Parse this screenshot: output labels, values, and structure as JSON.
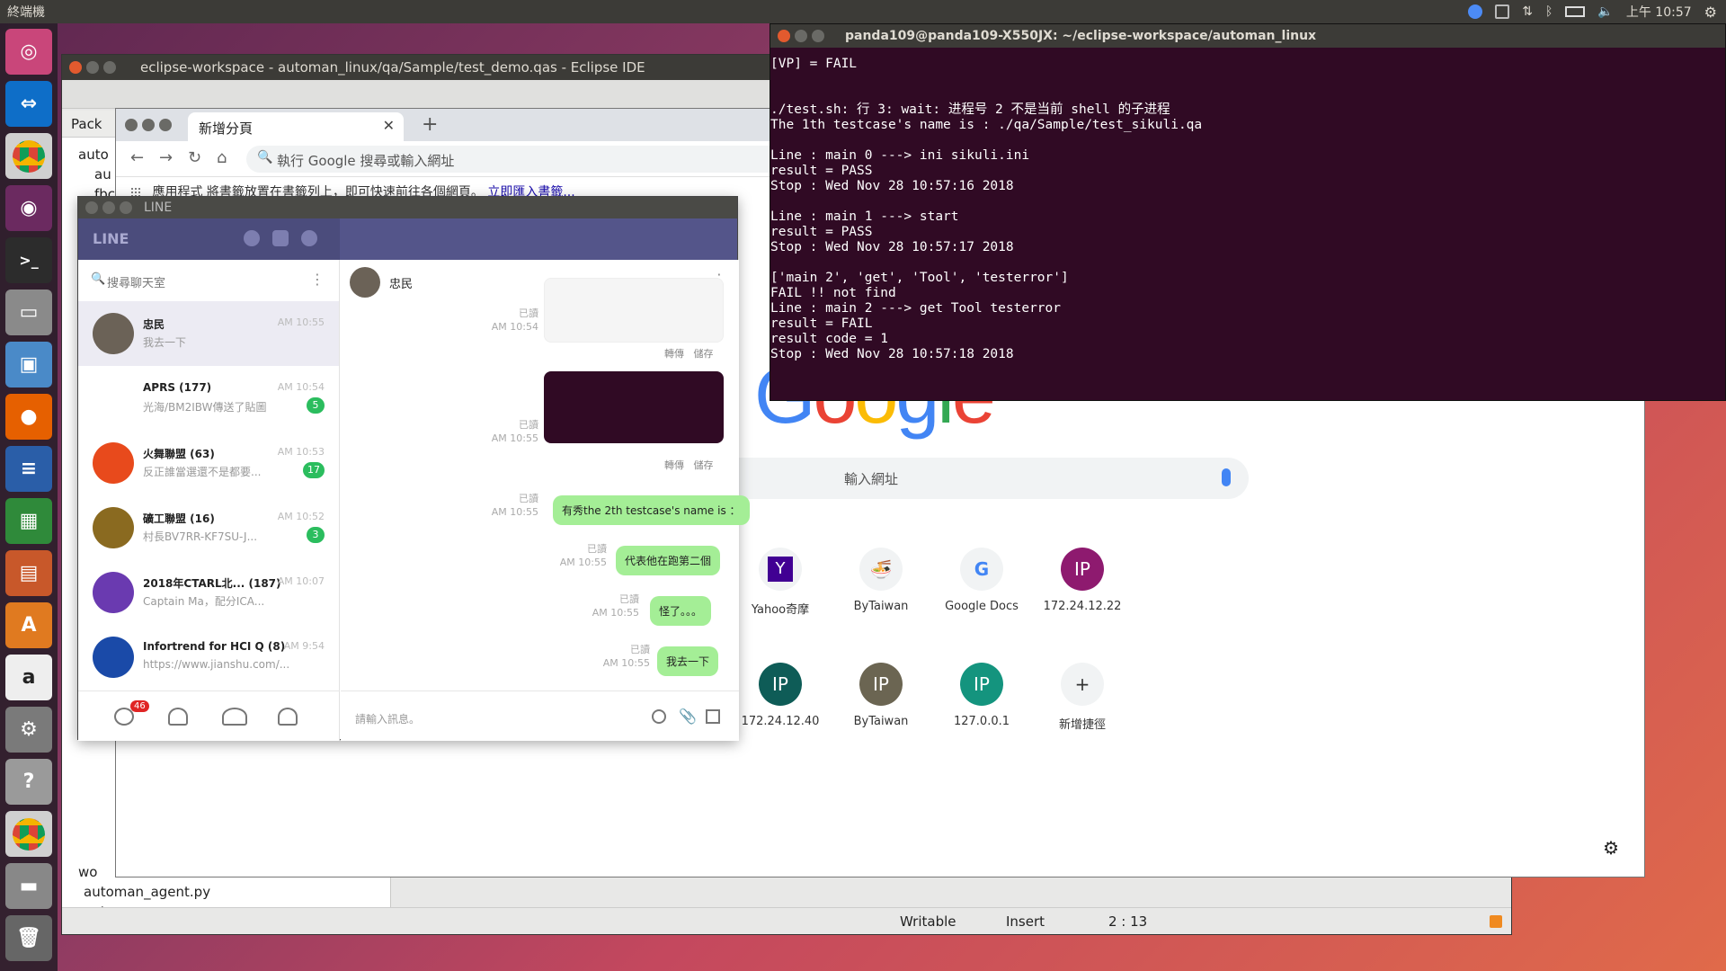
{
  "topbar": {
    "app_name": "終端機",
    "time": "上午 10:57"
  },
  "launcher": {
    "items": [
      "ubuntu",
      "teamviewer",
      "chrome",
      "obs",
      "terminal",
      "files",
      "remote",
      "firefox",
      "writer",
      "calc",
      "impress",
      "software",
      "amazon",
      "settings",
      "help",
      "chrome",
      "disk",
      "trash"
    ]
  },
  "eclipse": {
    "title": "eclipse-workspace - automan_linux/qa/Sample/test_demo.qas - Eclipse IDE",
    "tree_tab": "Pack",
    "tree_items": [
      "auto",
      "au",
      "fbc",
      "wo",
      "automan_agent.py",
      "automan.py"
    ],
    "status_writable": "Writable",
    "status_insert": "Insert",
    "status_pos": "2 : 13"
  },
  "chrome": {
    "tab_title": "新增分頁",
    "omnibox_placeholder": "執行 Google 搜尋或輸入網址",
    "bookmarks_text": "應用程式 將書籤放置在書籤列上，即可快速前往各個網頁。",
    "bookmarks_link": "立即匯入書籤...",
    "search_placeholder": "輸入網址",
    "shortcuts": [
      {
        "label": "Yahoo奇摩",
        "icon": "Y",
        "color": "#410093"
      },
      {
        "label": "ByTaiwan",
        "icon": "🍜",
        "color": "#f1f3f4"
      },
      {
        "label": "Google Docs",
        "icon": "G",
        "color": "#f1f3f4"
      },
      {
        "label": "172.24.12.22",
        "icon": "IP",
        "color": "#8e1a6f"
      },
      {
        "label": "172.24.12.40",
        "icon": "IP",
        "color": "#0e5c57"
      },
      {
        "label": "ByTaiwan",
        "icon": "IP",
        "color": "#6b6552"
      },
      {
        "label": "127.0.0.1",
        "icon": "IP",
        "color": "#14947e"
      },
      {
        "label": "新增捷徑",
        "icon": "+",
        "color": "#f1f3f4"
      }
    ]
  },
  "line": {
    "window_title": "LINE",
    "brand": "LINE",
    "search_placeholder": "搜尋聊天室",
    "unread_count": "46",
    "chats": [
      {
        "name": "忠民",
        "preview": "我去一下",
        "time": "AM 10:55",
        "badge": "",
        "color": "#6b6257"
      },
      {
        "name": "APRS  (177)",
        "preview": "光海/BM2IBW傳送了貼圖",
        "time": "AM 10:54",
        "badge": "5",
        "color": "#ffffff"
      },
      {
        "name": "火舞聯盟  (63)",
        "preview": "反正誰當選還不是都要...",
        "time": "AM 10:53",
        "badge": "17",
        "color": "#e84a1c"
      },
      {
        "name": "礦工聯盟  (16)",
        "preview": "村長BV7RR-KF7SU-J...",
        "time": "AM 10:52",
        "badge": "3",
        "color": "#8a6a20"
      },
      {
        "name": "2018年CTARL北...  (187)",
        "preview": "Captain Ma，配分ICA...",
        "time": "AM 10:07",
        "badge": "",
        "color": "#6a3ab0"
      },
      {
        "name": "Infortrend for HCI Q  (8)",
        "preview": "https://www.jianshu.com/...",
        "time": "AM 9:54",
        "badge": "",
        "color": "#1a4aa8"
      }
    ],
    "chat_name": "忠民",
    "messages": [
      {
        "read": "已讀",
        "time": "AM 10:54",
        "type": "image"
      },
      {
        "read": "已讀",
        "time": "AM 10:55",
        "type": "image"
      },
      {
        "read": "已讀",
        "time": "AM 10:55",
        "text": "有秀the 2th testcase's name is ："
      },
      {
        "read": "已讀",
        "time": "AM 10:55",
        "text": "代表他在跑第二個"
      },
      {
        "read": "已讀",
        "time": "AM 10:55",
        "text": "怪了。。。"
      },
      {
        "read": "已讀",
        "time": "AM 10:55",
        "text": "我去一下"
      }
    ],
    "forward": "轉傳",
    "save": "儲存",
    "input_placeholder": "請輸入訊息。"
  },
  "terminal": {
    "title": "panda109@panda109-X550JX: ~/eclipse-workspace/automan_linux",
    "lines": [
      "[VP] = FAIL",
      "",
      "",
      "./test.sh: 行 3: wait: 进程号 2 不是当前 shell 的子进程",
      "The 1th testcase's name is : ./qa/Sample/test_sikuli.qa",
      "",
      "Line : main 0 ---> ini sikuli.ini",
      "result = PASS",
      "Stop : Wed Nov 28 10:57:16 2018",
      "",
      "Line : main 1 ---> start",
      "result = PASS",
      "Stop : Wed Nov 28 10:57:17 2018",
      "",
      "['main 2', 'get', 'Tool', 'testerror']",
      "FAIL !! not find",
      "Line : main 2 ---> get Tool testerror",
      "result = FAIL",
      "result code = 1",
      "Stop : Wed Nov 28 10:57:18 2018"
    ]
  }
}
